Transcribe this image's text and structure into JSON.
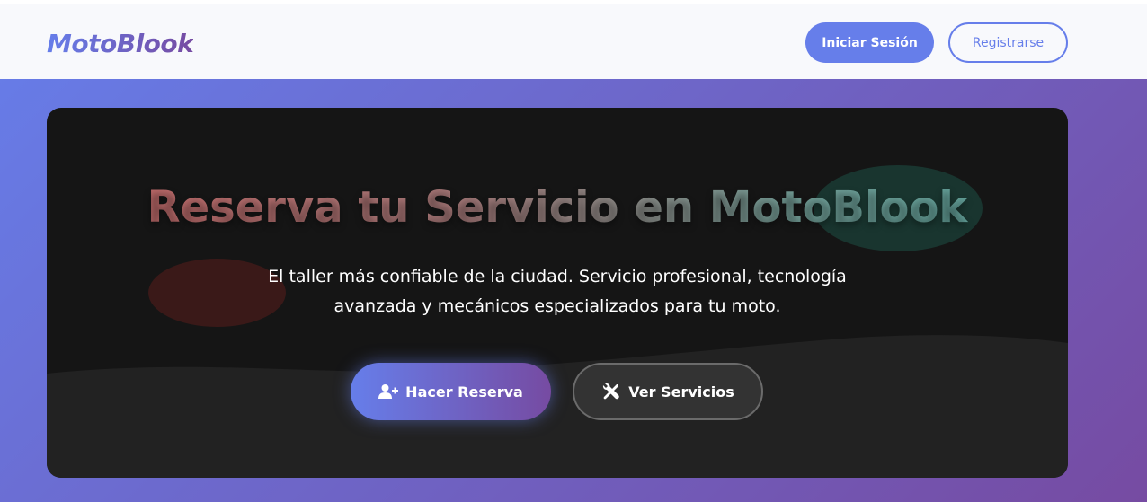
{
  "navbar": {
    "brand": "MotoBlook",
    "login_label": "Iniciar Sesión",
    "register_label": "Registrarse"
  },
  "hero": {
    "title": "Reserva tu Servicio en MotoBlook",
    "subtitle": "El taller más confiable de la ciudad. Servicio profesional, tecnología avanzada y mecánicos especializados para tu moto.",
    "reserve_button": {
      "label": "Hacer Reserva",
      "icon": "user-plus-icon"
    },
    "services_button": {
      "label": "Ver Servicios",
      "icon": "tools-icon"
    }
  },
  "colors": {
    "accent": "#667eea",
    "accent_dark": "#764ba2",
    "hero_bg": "#151515",
    "navbar_bg": "#f8f9fc"
  }
}
